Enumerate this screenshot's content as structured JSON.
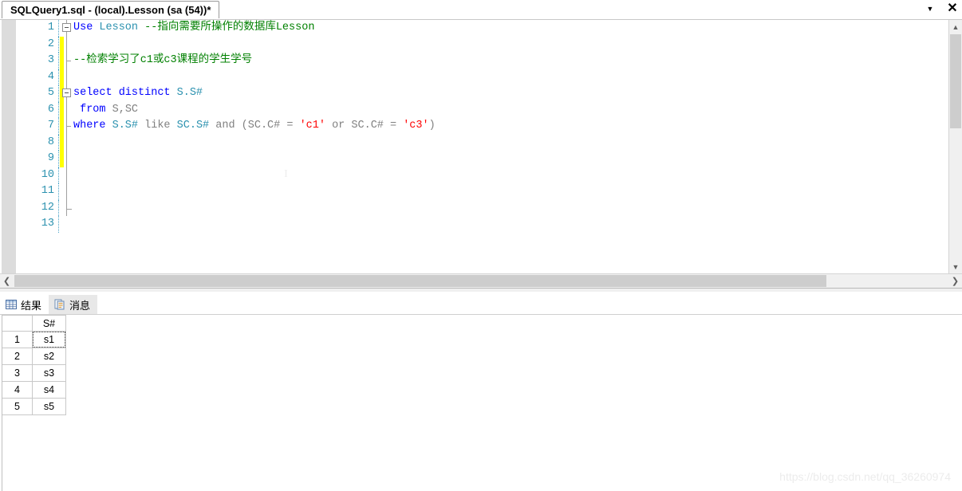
{
  "window": {
    "tab_title": "SQLQuery1.sql - (local).Lesson (sa (54))*",
    "dropdown_icon": "chevron-down-icon",
    "close_icon": "close-icon"
  },
  "editor": {
    "lines": [
      {
        "number": "1",
        "tokens": [
          {
            "text": "Use ",
            "style": "kw"
          },
          {
            "text": "Lesson ",
            "style": "ident"
          },
          {
            "text": "--指向需要所操作的数据库Lesson",
            "style": "cmt"
          }
        ]
      },
      {
        "number": "2",
        "tokens": []
      },
      {
        "number": "3",
        "tokens": [
          {
            "text": "--检索学习了c1或c3课程的学生学号",
            "style": "cmt"
          }
        ]
      },
      {
        "number": "4",
        "tokens": []
      },
      {
        "number": "5",
        "tokens": [
          {
            "text": "select distinct ",
            "style": "kw"
          },
          {
            "text": "S.S#",
            "style": "ident"
          }
        ]
      },
      {
        "number": "6",
        "tokens": [
          {
            "text": " ",
            "style": "plain"
          },
          {
            "text": "from ",
            "style": "kw"
          },
          {
            "text": "S,SC",
            "style": "plain"
          }
        ]
      },
      {
        "number": "7",
        "tokens": [
          {
            "text": "where ",
            "style": "kw"
          },
          {
            "text": "S.S# ",
            "style": "ident"
          },
          {
            "text": "like ",
            "style": "plain"
          },
          {
            "text": "SC.S# ",
            "style": "ident"
          },
          {
            "text": "and ",
            "style": "plain"
          },
          {
            "text": "(SC.C# = ",
            "style": "plain"
          },
          {
            "text": "'c1'",
            "style": "str"
          },
          {
            "text": " or ",
            "style": "plain"
          },
          {
            "text": "SC.C# = ",
            "style": "plain"
          },
          {
            "text": "'c3'",
            "style": "str"
          },
          {
            "text": ")",
            "style": "plain"
          }
        ]
      },
      {
        "number": "8",
        "tokens": []
      },
      {
        "number": "9",
        "tokens": []
      },
      {
        "number": "10",
        "tokens": []
      },
      {
        "number": "11",
        "tokens": []
      },
      {
        "number": "12",
        "tokens": []
      },
      {
        "number": "13",
        "tokens": []
      }
    ],
    "vertical_scrollbar": {
      "up_icon": "chevron-up-icon",
      "down_icon": "chevron-down-icon"
    },
    "horizontal_scrollbar": {
      "left_icon": "chevron-left-icon",
      "right_icon": "chevron-right-icon"
    }
  },
  "results": {
    "tabs": [
      {
        "label": "结果",
        "icon": "grid-icon",
        "active": true
      },
      {
        "label": "消息",
        "icon": "message-page-icon",
        "active": false
      }
    ],
    "grid": {
      "columns": [
        "",
        "S#"
      ],
      "rows": [
        {
          "num": "1",
          "value": "s1"
        },
        {
          "num": "2",
          "value": "s2"
        },
        {
          "num": "3",
          "value": "s3"
        },
        {
          "num": "4",
          "value": "s4"
        },
        {
          "num": "5",
          "value": "s5"
        }
      ],
      "selected_cell": "s1"
    }
  },
  "watermark": "https://blog.csdn.net/qq_36260974",
  "colors": {
    "keyword": "#0000ff",
    "identifier": "#2b91af",
    "comment": "#008000",
    "string": "#ff0000",
    "linenumber": "#2b91af",
    "changebar": "#ffff00"
  }
}
